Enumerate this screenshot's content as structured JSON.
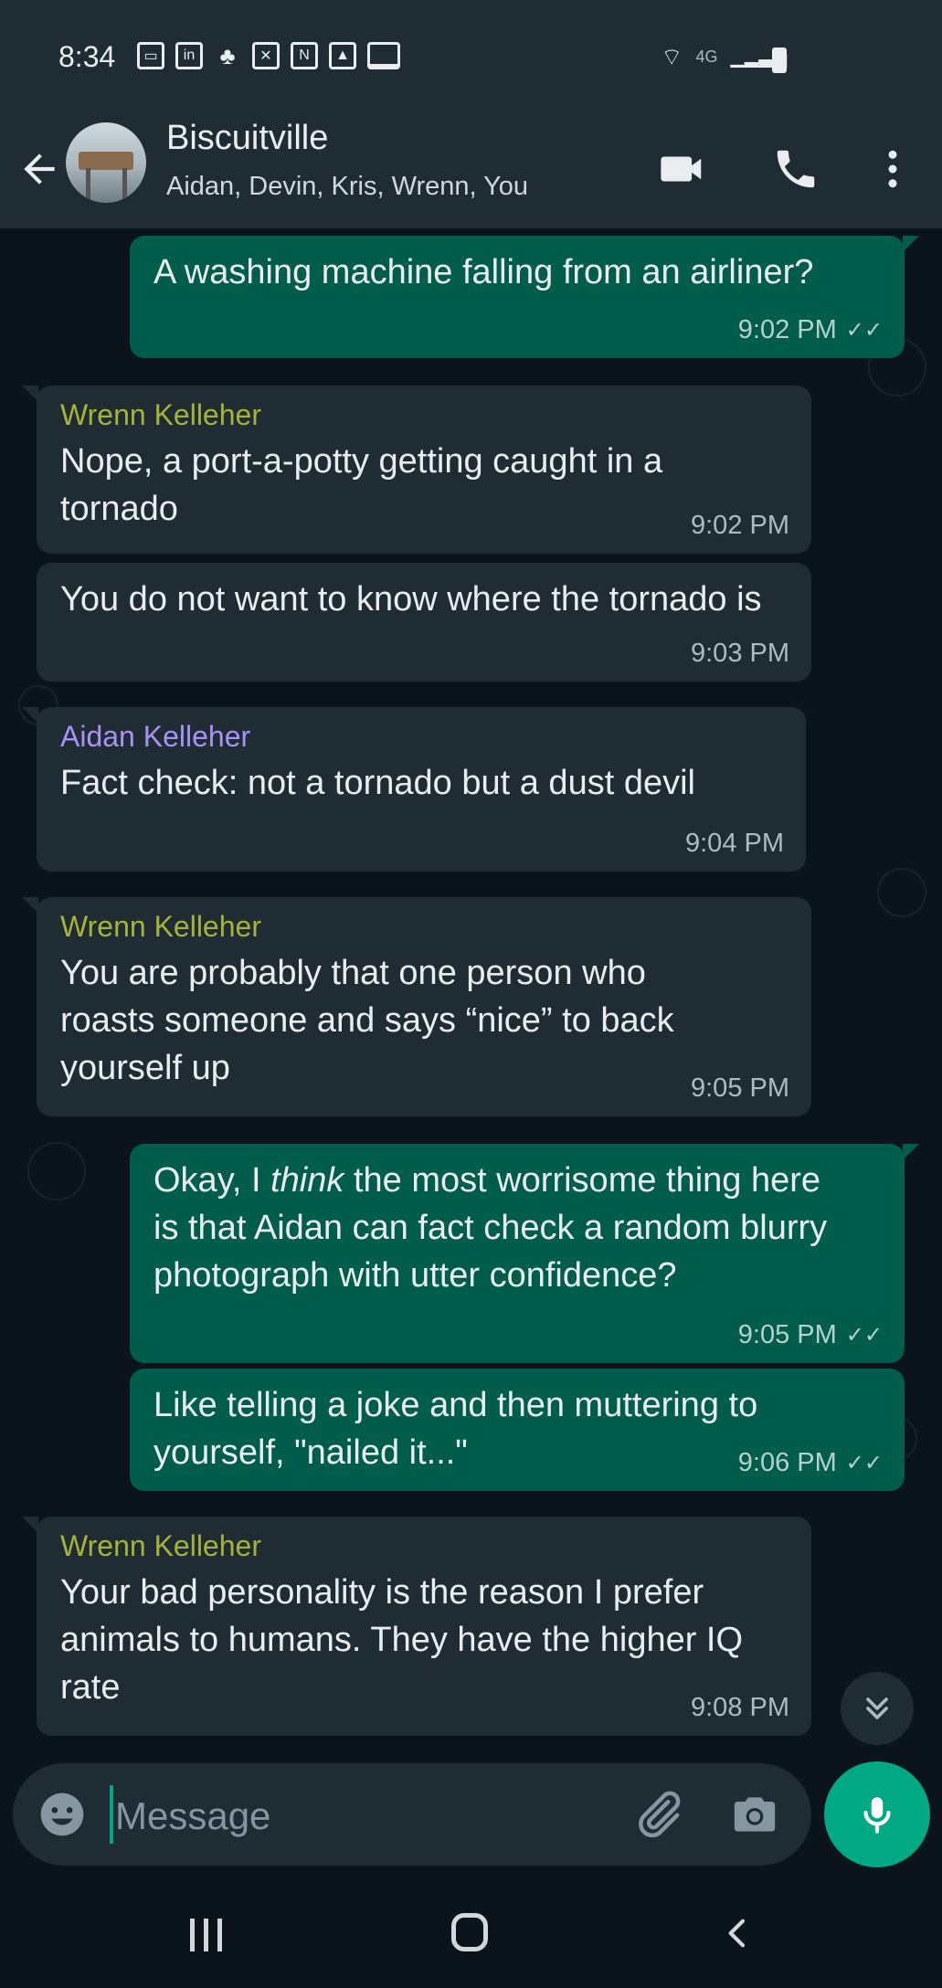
{
  "status_bar": {
    "time": "8:34",
    "network": "4G"
  },
  "header": {
    "group_name": "Biscuitville",
    "members": "Aidan, Devin, Kris, Wrenn, You"
  },
  "messages": [
    {
      "direction": "out",
      "text": "A washing machine falling from an airliner?",
      "time": "9:02 PM"
    },
    {
      "direction": "in",
      "sender": "Wrenn Kelleher",
      "text": "Nope, a port-a-potty getting caught in a tornado",
      "time": "9:02 PM"
    },
    {
      "direction": "in",
      "text": "You do not want to know where the tornado is",
      "time": "9:03 PM"
    },
    {
      "direction": "in",
      "sender": "Aidan Kelleher",
      "text": "Fact check: not a tornado but a dust devil",
      "time": "9:04 PM"
    },
    {
      "direction": "in",
      "sender": "Wrenn Kelleher",
      "text": "You are probably that one person who roasts someone and says “nice” to back yourself up",
      "time": "9:05 PM"
    },
    {
      "direction": "out",
      "text_before": "Okay, I ",
      "text_em": "think",
      "text_after": " the most worrisome thing here is that Aidan can fact check a random blurry photograph with utter confidence?",
      "time": "9:05 PM"
    },
    {
      "direction": "out",
      "text": "Like telling a joke and then muttering to yourself, \"nailed it...\"",
      "time": "9:06 PM"
    },
    {
      "direction": "in",
      "sender": "Wrenn Kelleher",
      "text": "Your bad personality is the reason I prefer animals to humans. They have the higher IQ rate",
      "time": "9:08 PM"
    }
  ],
  "composer": {
    "placeholder": "Message"
  },
  "colors": {
    "outgoing_bubble": "#005c4b",
    "incoming_bubble": "#1f2c34",
    "wrenn_name": "#a6b336",
    "aidan_name": "#a991f7",
    "accent": "#00a884"
  }
}
